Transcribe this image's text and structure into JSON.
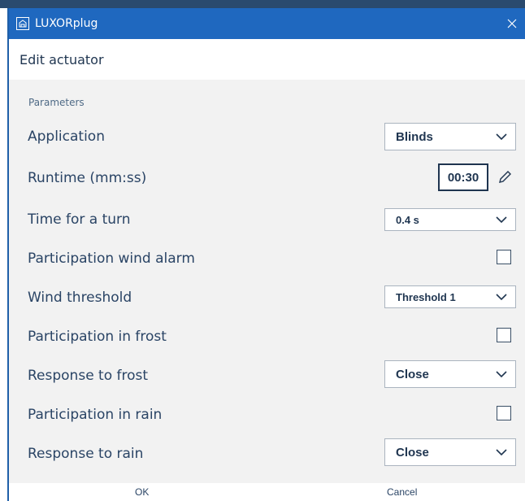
{
  "window": {
    "title": "LUXORplug",
    "app_icon": "luxor-app-icon",
    "close_icon": "close-icon"
  },
  "header": {
    "title": "Edit actuator"
  },
  "section": {
    "label": "Parameters"
  },
  "fields": {
    "application": {
      "label": "Application",
      "value": "Blinds"
    },
    "runtime": {
      "label": "Runtime (mm:ss)",
      "value": "00:30"
    },
    "turn_time": {
      "label": "Time for a turn",
      "value": "0.4 s"
    },
    "wind_alarm": {
      "label": "Participation wind alarm",
      "checked": false
    },
    "wind_threshold": {
      "label": "Wind threshold",
      "value": "Threshold 1"
    },
    "frost_participation": {
      "label": "Participation in frost",
      "checked": false
    },
    "frost_response": {
      "label": "Response to frost",
      "value": "Close"
    },
    "rain_participation": {
      "label": "Participation in rain",
      "checked": false
    },
    "rain_response": {
      "label": "Response to rain",
      "value": "Close"
    }
  },
  "footer": {
    "ok_label": "OK",
    "cancel_label": "Cancel"
  },
  "colors": {
    "titlebar": "#1f68bf",
    "panel": "#f2f2f2",
    "text": "#1f3550"
  }
}
